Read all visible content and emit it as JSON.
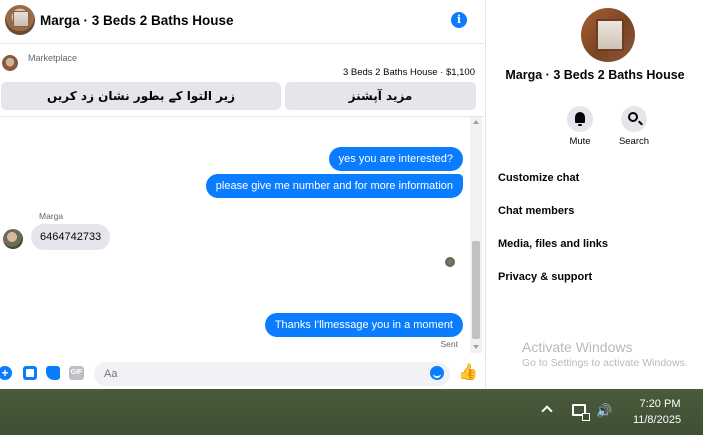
{
  "header": {
    "title": "Marga · 3 Beds 2 Baths House"
  },
  "marketplace": {
    "label": "Marketplace",
    "listing": "3 Beds 2 Baths House · $1,100",
    "actions": [
      "زیر التوا کے بطور نشان زد کریں",
      "مزید آپشنز"
    ]
  },
  "messages": {
    "outgoing_1": "yes you are interested?",
    "outgoing_2": "please give me number and for more information",
    "sender_name": "Marga",
    "incoming_1": "6464742733",
    "outgoing_3": "Thanks I'llmessage you in a moment",
    "status": "Sent"
  },
  "composer": {
    "placeholder": "Aa",
    "gif_label": "GIF"
  },
  "info_panel": {
    "title": "Marga · 3 Beds 2 Baths House",
    "mute_label": "Mute",
    "search_label": "Search",
    "menu": [
      "Customize chat",
      "Chat members",
      "Media, files and links",
      "Privacy & support"
    ]
  },
  "watermark": {
    "title": "Activate Windows",
    "subtitle": "Go to Settings to activate Windows."
  },
  "taskbar": {
    "time": "7:20 PM",
    "date": "11/8/2025"
  },
  "colors": {
    "accent": "#0a7cff",
    "incoming_bubble": "#e4e6eb",
    "taskbar": "#44543a"
  }
}
